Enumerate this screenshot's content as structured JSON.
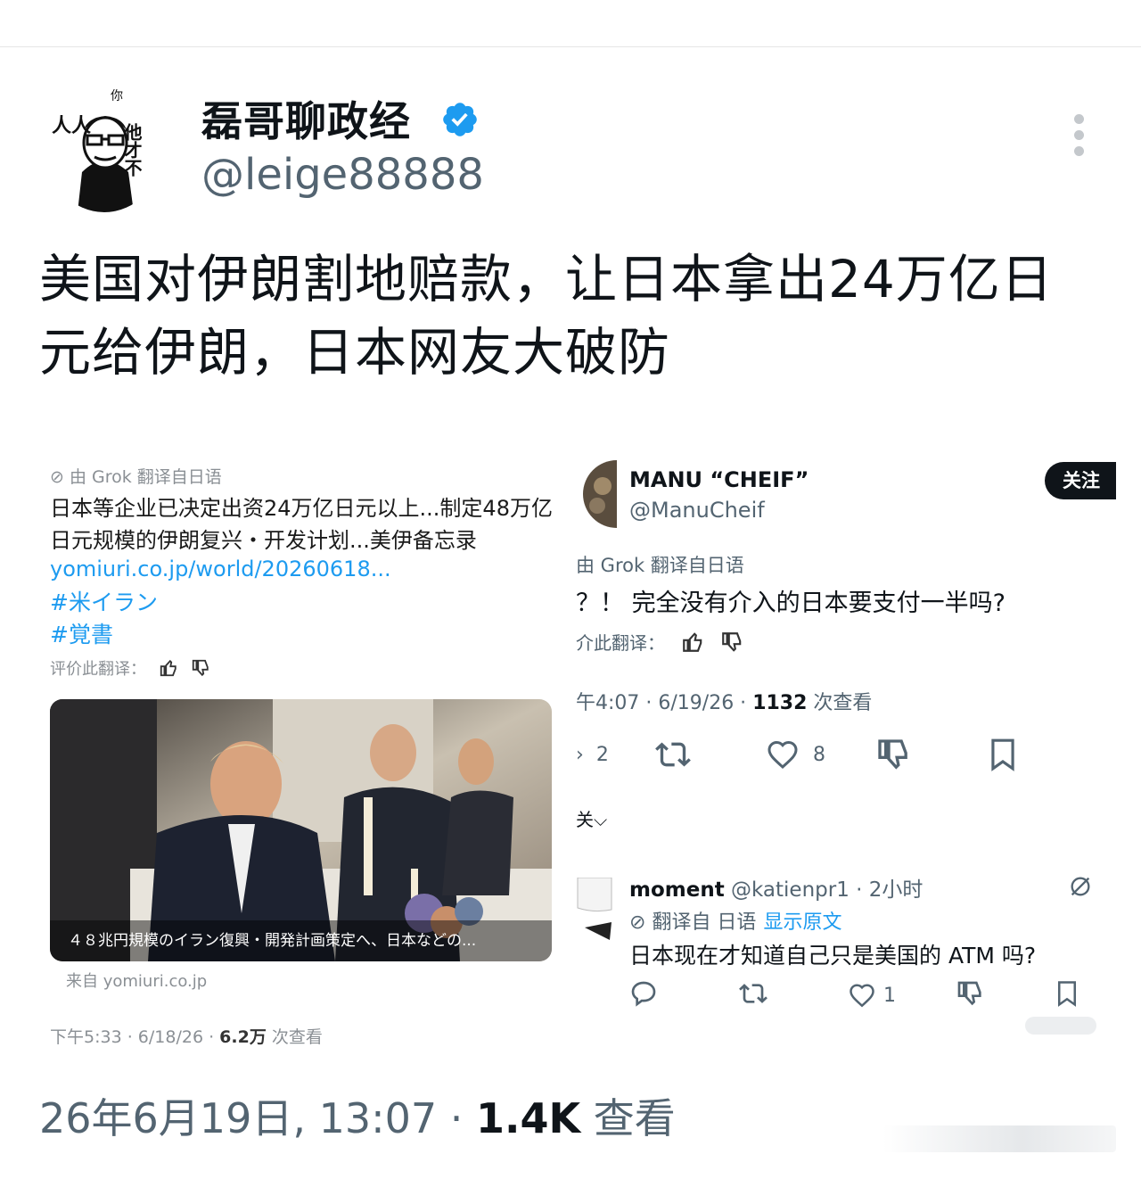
{
  "post": {
    "author_name": "磊哥聊政经",
    "handle": "@leige88888",
    "text": "美国对伊朗割地赔款，让日本拿出24万亿日元给伊朗，日本网友大破防",
    "timestamp": "26年6月19日, 13:07 · ",
    "views": "1.4K",
    "views_label": " 查看",
    "avatar_text": [
      "人人",
      "他才不",
      "你"
    ]
  },
  "left_quote": {
    "translated_by": "由 Grok 翻译自日语",
    "text": "日本等企业已决定出资24万亿日元以上...制定48万亿日元规模的伊朗复兴・开发计划...美伊备忘录",
    "url": "yomiuri.co.jp/world/20260618...",
    "hashtag1": "#米イラン",
    "hashtag2": "#覚書",
    "rate_label": "评价此翻译：",
    "image_caption": "４８兆円規模のイラン復興・開発計画策定へ、日本などの...",
    "source": "来自 yomiuri.co.jp",
    "meta_prefix": "下午5:33 · 6/18/26 · ",
    "views": "6.2万",
    "views_label": " 次查看"
  },
  "right_quote": {
    "name": "MANU “CHEIF”",
    "handle": "@ManuCheif",
    "follow_label": "关注",
    "translated_by": "由 Grok 翻译自日语",
    "text": "？！ 完全没有介入的日本要支付一半吗?",
    "rate_label": "介此翻译：",
    "meta_prefix": "午4:07 · 6/19/26 · ",
    "views": "1132",
    "views_label": " 次查看",
    "replies": "2",
    "likes": "8",
    "related_label": "关"
  },
  "reply": {
    "name": "moment",
    "handle_time": " @katienpr1 · 2小时",
    "translated_from": "翻译自 日语",
    "show_original": "显示原文",
    "text": "日本现在才知道自己只是美国的 ATM 吗?",
    "likes": "1"
  },
  "colors": {
    "accent": "#1d9bf0",
    "text": "#0f1419",
    "muted": "#536471"
  },
  "icons": [
    "verified-badge-icon",
    "more-icon",
    "grok-icon",
    "thumbs-up-icon",
    "thumbs-down-icon",
    "reply-icon",
    "retweet-icon",
    "heart-icon",
    "bookmark-icon",
    "chevron-down-icon"
  ]
}
